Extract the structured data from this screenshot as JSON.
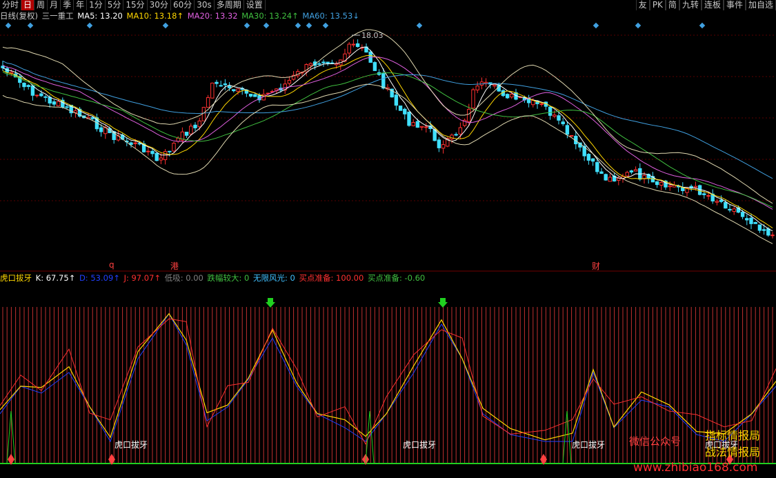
{
  "toolbar": {
    "left_items": [
      "分时",
      "日",
      "周",
      "月",
      "季",
      "年",
      "1分",
      "5分",
      "15分",
      "30分",
      "60分",
      "30s",
      "多周期",
      "设置"
    ],
    "active_index": 1,
    "right_items": [
      "友",
      "PK",
      "简",
      "九转",
      "连板",
      "事件",
      "加自选"
    ]
  },
  "ma_legend": {
    "title": "日线(复权)",
    "stock": "三一重工",
    "items": [
      {
        "label": "MA5: 13.20",
        "color": "#ffffff"
      },
      {
        "label": "MA10: 13.18↑",
        "color": "#ffd700"
      },
      {
        "label": "MA20: 13.32",
        "color": "#e060e0"
      },
      {
        "label": "MA30: 13.24↑",
        "color": "#40c040"
      },
      {
        "label": "MA60: 13.53↓",
        "color": "#40a0e0"
      }
    ]
  },
  "price_high_label": "18.03",
  "event_tags": [
    {
      "text": "q",
      "color": "#ff3030"
    },
    {
      "text": "港",
      "color": "#ff3030"
    },
    {
      "text": "财",
      "color": "#ff3030"
    }
  ],
  "indicator_legend": {
    "items": [
      {
        "label": "虎口拔牙",
        "color": "#ffd700"
      },
      {
        "label": "K: 67.75↑",
        "color": "#ffffff"
      },
      {
        "label": "D: 53.09↑",
        "color": "#2040ff"
      },
      {
        "label": "J: 97.07↑",
        "color": "#ff3030"
      },
      {
        "label": "低吸: 0.00",
        "color": "#808080"
      },
      {
        "label": "跌幅较大: 0",
        "color": "#40c040"
      },
      {
        "label": "无限风光: 0",
        "color": "#40c0ff"
      },
      {
        "label": "买点准备: 100.00",
        "color": "#ff3030"
      },
      {
        "label": "买点准备: -0.60",
        "color": "#40c040"
      }
    ]
  },
  "annotations": {
    "label_1": "虎口拔牙",
    "label_2": "虎口拔牙",
    "label_3": "虎口拔牙",
    "label_4": "虎口拔牙"
  },
  "watermark": {
    "line1": "指标情报局",
    "line2": "战法情报局",
    "line3": "微信公众号",
    "url": "www.zhibiao168.com"
  },
  "colors": {
    "up": "#ff3030",
    "down": "#40e0ff",
    "grid": "#5a0000",
    "bg": "#000000"
  }
}
